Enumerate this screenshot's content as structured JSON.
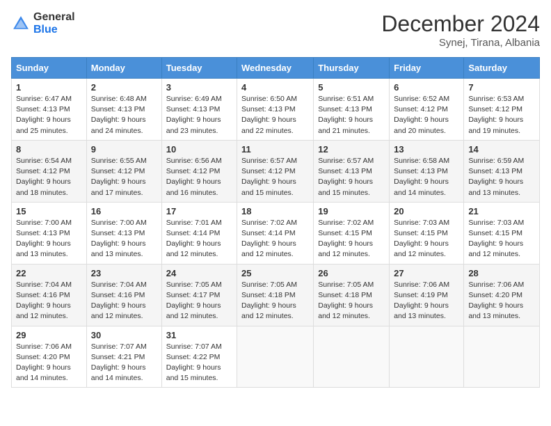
{
  "header": {
    "logo_general": "General",
    "logo_blue": "Blue",
    "month_title": "December 2024",
    "location": "Synej, Tirana, Albania"
  },
  "days_of_week": [
    "Sunday",
    "Monday",
    "Tuesday",
    "Wednesday",
    "Thursday",
    "Friday",
    "Saturday"
  ],
  "weeks": [
    [
      {
        "day": "1",
        "info": "Sunrise: 6:47 AM\nSunset: 4:13 PM\nDaylight: 9 hours and 25 minutes."
      },
      {
        "day": "2",
        "info": "Sunrise: 6:48 AM\nSunset: 4:13 PM\nDaylight: 9 hours and 24 minutes."
      },
      {
        "day": "3",
        "info": "Sunrise: 6:49 AM\nSunset: 4:13 PM\nDaylight: 9 hours and 23 minutes."
      },
      {
        "day": "4",
        "info": "Sunrise: 6:50 AM\nSunset: 4:13 PM\nDaylight: 9 hours and 22 minutes."
      },
      {
        "day": "5",
        "info": "Sunrise: 6:51 AM\nSunset: 4:13 PM\nDaylight: 9 hours and 21 minutes."
      },
      {
        "day": "6",
        "info": "Sunrise: 6:52 AM\nSunset: 4:12 PM\nDaylight: 9 hours and 20 minutes."
      },
      {
        "day": "7",
        "info": "Sunrise: 6:53 AM\nSunset: 4:12 PM\nDaylight: 9 hours and 19 minutes."
      }
    ],
    [
      {
        "day": "8",
        "info": "Sunrise: 6:54 AM\nSunset: 4:12 PM\nDaylight: 9 hours and 18 minutes."
      },
      {
        "day": "9",
        "info": "Sunrise: 6:55 AM\nSunset: 4:12 PM\nDaylight: 9 hours and 17 minutes."
      },
      {
        "day": "10",
        "info": "Sunrise: 6:56 AM\nSunset: 4:12 PM\nDaylight: 9 hours and 16 minutes."
      },
      {
        "day": "11",
        "info": "Sunrise: 6:57 AM\nSunset: 4:12 PM\nDaylight: 9 hours and 15 minutes."
      },
      {
        "day": "12",
        "info": "Sunrise: 6:57 AM\nSunset: 4:13 PM\nDaylight: 9 hours and 15 minutes."
      },
      {
        "day": "13",
        "info": "Sunrise: 6:58 AM\nSunset: 4:13 PM\nDaylight: 9 hours and 14 minutes."
      },
      {
        "day": "14",
        "info": "Sunrise: 6:59 AM\nSunset: 4:13 PM\nDaylight: 9 hours and 13 minutes."
      }
    ],
    [
      {
        "day": "15",
        "info": "Sunrise: 7:00 AM\nSunset: 4:13 PM\nDaylight: 9 hours and 13 minutes."
      },
      {
        "day": "16",
        "info": "Sunrise: 7:00 AM\nSunset: 4:13 PM\nDaylight: 9 hours and 13 minutes."
      },
      {
        "day": "17",
        "info": "Sunrise: 7:01 AM\nSunset: 4:14 PM\nDaylight: 9 hours and 12 minutes."
      },
      {
        "day": "18",
        "info": "Sunrise: 7:02 AM\nSunset: 4:14 PM\nDaylight: 9 hours and 12 minutes."
      },
      {
        "day": "19",
        "info": "Sunrise: 7:02 AM\nSunset: 4:15 PM\nDaylight: 9 hours and 12 minutes."
      },
      {
        "day": "20",
        "info": "Sunrise: 7:03 AM\nSunset: 4:15 PM\nDaylight: 9 hours and 12 minutes."
      },
      {
        "day": "21",
        "info": "Sunrise: 7:03 AM\nSunset: 4:15 PM\nDaylight: 9 hours and 12 minutes."
      }
    ],
    [
      {
        "day": "22",
        "info": "Sunrise: 7:04 AM\nSunset: 4:16 PM\nDaylight: 9 hours and 12 minutes."
      },
      {
        "day": "23",
        "info": "Sunrise: 7:04 AM\nSunset: 4:16 PM\nDaylight: 9 hours and 12 minutes."
      },
      {
        "day": "24",
        "info": "Sunrise: 7:05 AM\nSunset: 4:17 PM\nDaylight: 9 hours and 12 minutes."
      },
      {
        "day": "25",
        "info": "Sunrise: 7:05 AM\nSunset: 4:18 PM\nDaylight: 9 hours and 12 minutes."
      },
      {
        "day": "26",
        "info": "Sunrise: 7:05 AM\nSunset: 4:18 PM\nDaylight: 9 hours and 12 minutes."
      },
      {
        "day": "27",
        "info": "Sunrise: 7:06 AM\nSunset: 4:19 PM\nDaylight: 9 hours and 13 minutes."
      },
      {
        "day": "28",
        "info": "Sunrise: 7:06 AM\nSunset: 4:20 PM\nDaylight: 9 hours and 13 minutes."
      }
    ],
    [
      {
        "day": "29",
        "info": "Sunrise: 7:06 AM\nSunset: 4:20 PM\nDaylight: 9 hours and 14 minutes."
      },
      {
        "day": "30",
        "info": "Sunrise: 7:07 AM\nSunset: 4:21 PM\nDaylight: 9 hours and 14 minutes."
      },
      {
        "day": "31",
        "info": "Sunrise: 7:07 AM\nSunset: 4:22 PM\nDaylight: 9 hours and 15 minutes."
      },
      {
        "day": "",
        "info": ""
      },
      {
        "day": "",
        "info": ""
      },
      {
        "day": "",
        "info": ""
      },
      {
        "day": "",
        "info": ""
      }
    ]
  ]
}
